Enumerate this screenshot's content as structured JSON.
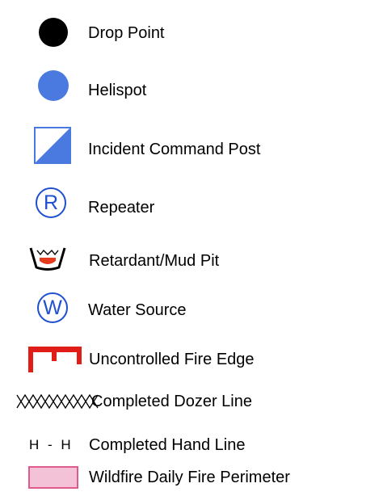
{
  "legend": {
    "items": [
      {
        "label": "Drop Point",
        "icon": "black-filled-circle-icon",
        "color": "#000000"
      },
      {
        "label": "Helispot",
        "icon": "blue-filled-circle-icon",
        "color": "#4a7ae0"
      },
      {
        "label": "Incident Command Post",
        "icon": "half-diagonal-square-icon",
        "color": "#4a7ae0"
      },
      {
        "label": "Repeater",
        "icon": "circled-r-icon",
        "color": "#1f4fd0",
        "symbol_text": "R"
      },
      {
        "label": "Retardant/Mud Pit",
        "icon": "mud-pit-icon",
        "color": "#e53b1e"
      },
      {
        "label": "Water Source",
        "icon": "circled-w-icon",
        "color": "#1f4fd0",
        "symbol_text": "W"
      },
      {
        "label": "Uncontrolled Fire Edge",
        "icon": "red-comb-line-icon",
        "color": "#e01d16"
      },
      {
        "label": "Completed Dozer Line",
        "icon": "crosshatch-line-icon",
        "color": "#000000"
      },
      {
        "label": "Completed Hand Line",
        "icon": "h-dash-h-line-icon",
        "color": "#000000",
        "symbol_text": "H - H"
      },
      {
        "label": "Wildfire Daily Fire Perimeter",
        "icon": "pink-box-icon",
        "color": "#f4c2d6",
        "border_color": "#e05a8e"
      }
    ]
  }
}
